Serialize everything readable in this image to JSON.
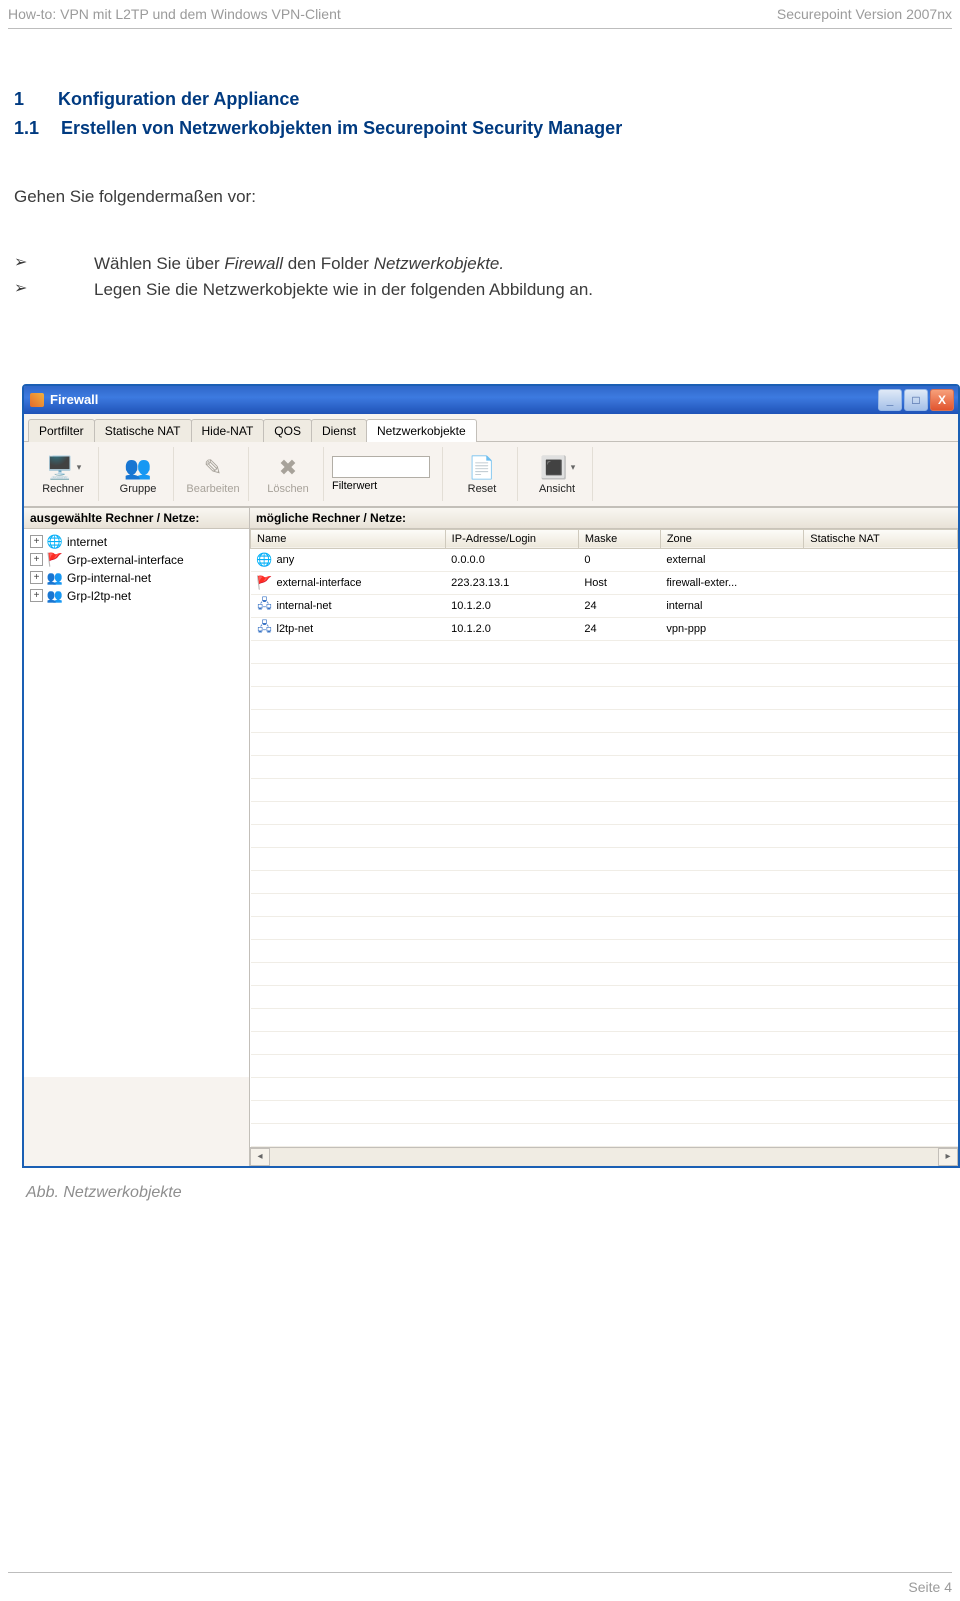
{
  "page": {
    "header_left": "How-to: VPN mit L2TP und dem Windows VPN-Client",
    "header_right": "Securepoint Version 2007nx",
    "footer": "Seite 4",
    "section_num": "1",
    "section_title": "Konfiguration der Appliance",
    "subsection_num": "1.1",
    "subsection_title": "Erstellen von Netzwerkobjekten im Securepoint Security Manager",
    "intro": "Gehen Sie folgendermaßen vor:",
    "bullet1_pre": "Wählen Sie über ",
    "bullet1_it1": "Firewall",
    "bullet1_mid": " den Folder ",
    "bullet1_it2": "Netzwerkobjekte.",
    "bullet2": "Legen Sie die Netzwerkobjekte wie in der folgenden Abbildung an.",
    "caption": "Abb. Netzwerkobjekte",
    "bullet_sym": "➢"
  },
  "app": {
    "title": "Firewall",
    "winbtn_min": "_",
    "winbtn_max": "□",
    "winbtn_close": "X",
    "tabs": [
      "Portfilter",
      "Statische NAT",
      "Hide-NAT",
      "QOS",
      "Dienst",
      "Netzwerkobjekte"
    ],
    "active_tab_index": 5,
    "toolbar": {
      "rechner": "Rechner",
      "gruppe": "Gruppe",
      "bearbeiten": "Bearbeiten",
      "loeschen": "Löschen",
      "filterwert": "Filterwert",
      "reset": "Reset",
      "ansicht": "Ansicht"
    },
    "left_title": "ausgewählte Rechner / Netze:",
    "right_title": "mögliche Rechner / Netze:",
    "tree": [
      {
        "exp": "+",
        "icon": "globe",
        "label": "internet"
      },
      {
        "exp": "+",
        "icon": "flag",
        "label": "Grp-external-interface"
      },
      {
        "exp": "+",
        "icon": "group",
        "label": "Grp-internal-net"
      },
      {
        "exp": "+",
        "icon": "group",
        "label": "Grp-l2tp-net"
      }
    ],
    "columns": [
      "Name",
      "IP-Adresse/Login",
      "Maske",
      "Zone",
      "Statische NAT"
    ],
    "col_widths": [
      "190px",
      "130px",
      "80px",
      "140px",
      "150px"
    ],
    "rows": [
      {
        "icon": "globe",
        "name": "any",
        "ip": "0.0.0.0",
        "mask": "0",
        "zone": "external",
        "snat": ""
      },
      {
        "icon": "flag",
        "name": "external-interface",
        "ip": "223.23.13.1",
        "mask": "Host",
        "zone": "firewall-exter...",
        "snat": ""
      },
      {
        "icon": "net",
        "name": "internal-net",
        "ip": "10.1.2.0",
        "mask": "24",
        "zone": "internal",
        "snat": ""
      },
      {
        "icon": "net",
        "name": "l2tp-net",
        "ip": "10.1.2.0",
        "mask": "24",
        "zone": "vpn-ppp",
        "snat": ""
      }
    ],
    "empty_rows": 22
  }
}
